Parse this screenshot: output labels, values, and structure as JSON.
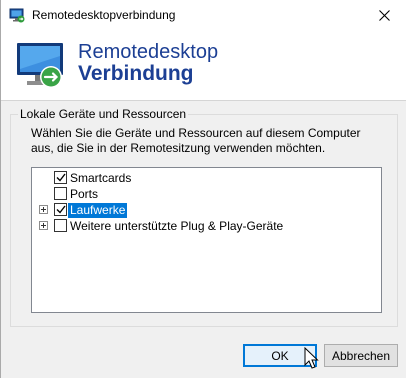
{
  "window": {
    "title": "Remotedesktopverbindung",
    "close_symbol": "✕"
  },
  "banner": {
    "line1": "Remotedesktop",
    "line2": "Verbindung",
    "icon": "remote-desktop-icon"
  },
  "group": {
    "legend": "Lokale Geräte und Ressourcen",
    "description": "Wählen Sie die Geräte und Ressourcen auf diesem Computer aus, die Sie in der Remotesitzung verwenden möchten.",
    "items": [
      {
        "label": "Smartcards",
        "checked": true,
        "expandable": false,
        "selected": false
      },
      {
        "label": "Ports",
        "checked": false,
        "expandable": false,
        "selected": false
      },
      {
        "label": "Laufwerke",
        "checked": true,
        "expandable": true,
        "selected": true
      },
      {
        "label": "Weitere unterstützte Plug & Play-Geräte",
        "checked": false,
        "expandable": true,
        "selected": false
      }
    ]
  },
  "buttons": {
    "ok": "OK",
    "cancel": "Abbrechen"
  },
  "colors": {
    "accent": "#0078d7",
    "banner_text": "#1c3f94"
  }
}
